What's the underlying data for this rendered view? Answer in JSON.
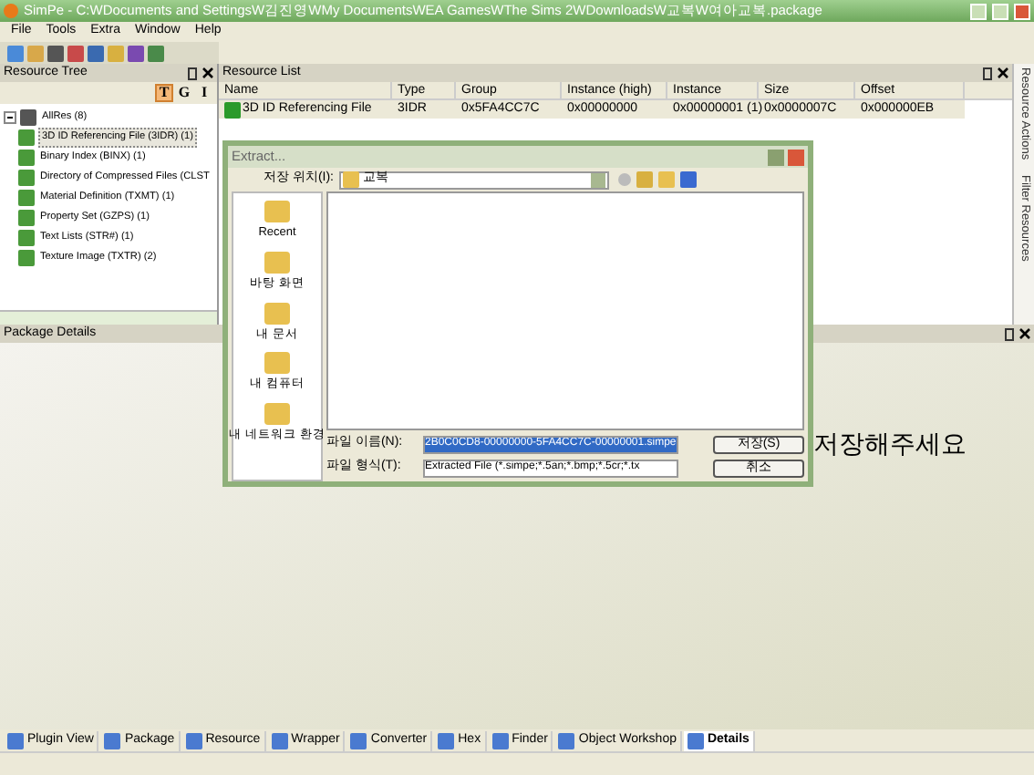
{
  "window": {
    "title": "SimPe - C:WDocuments and SettingsW김진영WMy DocumentsWEA GamesWThe Sims 2WDownloadsW교복W여아교복.package"
  },
  "menu": [
    "File",
    "Tools",
    "Extra",
    "Window",
    "Help"
  ],
  "resource_tree": {
    "title": "Resource Tree",
    "view_buttons": [
      {
        "label": "T",
        "selected": true
      },
      {
        "label": "G",
        "selected": false
      },
      {
        "label": "I",
        "selected": false
      }
    ],
    "items": [
      {
        "label": "AllRes (8)",
        "expanded": true,
        "children": [
          {
            "label": "3D ID Referencing File (3IDR) (1)",
            "selected": true
          },
          {
            "label": "Binary Index (BINX) (1)",
            "selected": false
          },
          {
            "label": "Directory of Compressed Files (CLST",
            "selected": false
          },
          {
            "label": "Material Definition (TXMT) (1)",
            "selected": false
          },
          {
            "label": "Property Set (GZPS) (1)",
            "selected": false
          },
          {
            "label": "Text Lists (STR#) (1)",
            "selected": false
          },
          {
            "label": "Texture Image (TXTR) (2)",
            "selected": false
          }
        ]
      }
    ]
  },
  "resource_list": {
    "title": "Resource List",
    "columns": [
      "Name",
      "Type",
      "Group",
      "Instance (high)",
      "Instance",
      "Size",
      "Offset"
    ],
    "rows": [
      {
        "cells": [
          "3D ID Referencing File",
          "3IDR",
          "0x5FA4CC7C",
          "0x00000000",
          "0x00000001 (1)",
          "0x0000007C",
          "0x000000EB"
        ],
        "selected": true
      }
    ]
  },
  "side_tabs": [
    "Resource Actions",
    "Filter Resources"
  ],
  "package_details": {
    "title": "Package Details"
  },
  "dialog": {
    "title": "Extract...",
    "save_in_label": "저장 위치(I):",
    "save_in_value": "교복",
    "places": [
      "Recent",
      "바탕 화면",
      "내 문서",
      "내 컴퓨터",
      "내 네트워크 환경"
    ],
    "filename_label": "파일 이름(N):",
    "filename_value": "2B0C0CD8-00000000-5FA4CC7C-00000001.simpe",
    "filetype_label": "파일 형식(T):",
    "filetype_value": "Extracted File (*.simpe;*.5an;*.bmp;*.5cr;*.tx",
    "buttons": [
      "저장(S)",
      "취소"
    ]
  },
  "overlay_note": "저장해주세요",
  "bottom_tabs": [
    {
      "label": "Plugin View",
      "selected": false
    },
    {
      "label": "Package",
      "selected": false
    },
    {
      "label": "Resource",
      "selected": false
    },
    {
      "label": "Wrapper",
      "selected": false
    },
    {
      "label": "Converter",
      "selected": false
    },
    {
      "label": "Hex",
      "selected": false
    },
    {
      "label": "Finder",
      "selected": false
    },
    {
      "label": "Object Workshop",
      "selected": false
    },
    {
      "label": "Details",
      "selected": true
    }
  ]
}
